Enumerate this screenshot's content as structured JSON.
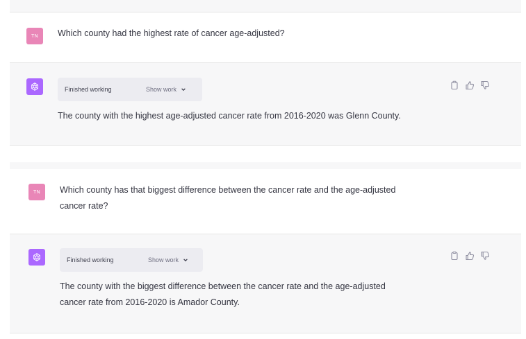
{
  "colors": {
    "user_avatar": "#e986b7",
    "assistant_avatar": "#ab68ff",
    "assistant_row_bg": "#f7f7f8",
    "pill_bg": "#ececf1"
  },
  "messages": [
    {
      "role": "user",
      "avatar_initials": "TN",
      "text": "Which county had the highest rate of cancer age-adjusted?"
    },
    {
      "role": "assistant",
      "avatar_icon": "openai-logo-icon",
      "work_status": "Finished working",
      "work_toggle": "Show work",
      "text": "The county with the highest age-adjusted cancer rate from 2016-2020 was Glenn County.",
      "actions": [
        "copy-icon",
        "thumbs-up-icon",
        "thumbs-down-icon"
      ]
    },
    {
      "role": "user",
      "avatar_initials": "TN",
      "text_lines": [
        "Which county has that biggest difference between the cancer rate and the age-adjusted",
        "cancer rate?"
      ]
    },
    {
      "role": "assistant",
      "avatar_icon": "openai-logo-icon",
      "work_status": "Finished working",
      "work_toggle": "Show work",
      "text_lines": [
        "The county with the biggest difference between the cancer rate and the age-adjusted",
        "cancer rate from 2016-2020 is Amador County."
      ],
      "actions": [
        "copy-icon",
        "thumbs-up-icon",
        "thumbs-down-icon"
      ]
    }
  ]
}
